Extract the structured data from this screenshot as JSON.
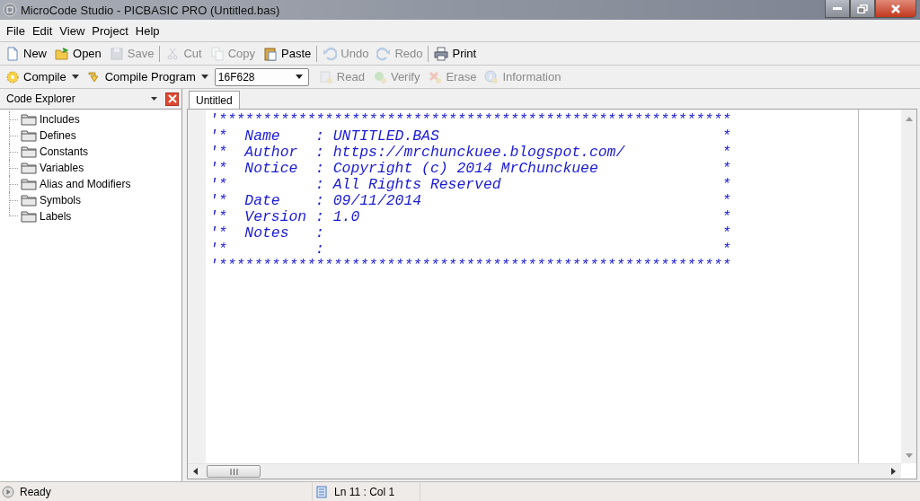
{
  "window": {
    "title": "MicroCode Studio - PICBASIC PRO (Untitled.bas)"
  },
  "menu": [
    "File",
    "Edit",
    "View",
    "Project",
    "Help"
  ],
  "toolbar": [
    {
      "kind": "button",
      "label": "New",
      "disabled": false
    },
    {
      "kind": "button",
      "label": "Open",
      "disabled": false
    },
    {
      "kind": "button",
      "label": "Save",
      "disabled": true
    },
    {
      "kind": "separator"
    },
    {
      "kind": "button",
      "label": "Cut",
      "disabled": true
    },
    {
      "kind": "button",
      "label": "Copy",
      "disabled": true
    },
    {
      "kind": "button",
      "label": "Paste",
      "disabled": false
    },
    {
      "kind": "separator"
    },
    {
      "kind": "button",
      "label": "Undo",
      "disabled": true
    },
    {
      "kind": "button",
      "label": "Redo",
      "disabled": true
    },
    {
      "kind": "separator"
    },
    {
      "kind": "button",
      "label": "Print",
      "disabled": false
    }
  ],
  "compile_bar": {
    "compile": "Compile",
    "compile_program": "Compile Program",
    "device": "16F628",
    "tools": [
      {
        "label": "Read",
        "disabled": true
      },
      {
        "label": "Verify",
        "disabled": true
      },
      {
        "label": "Erase",
        "disabled": true
      },
      {
        "label": "Information",
        "disabled": true
      }
    ]
  },
  "code_explorer": {
    "title": "Code Explorer",
    "items": [
      "Includes",
      "Defines",
      "Constants",
      "Variables",
      "Alias and Modifiers",
      "Symbols",
      "Labels"
    ]
  },
  "tabs": [
    {
      "label": "Untitled",
      "selected": true
    }
  ],
  "editor": {
    "lines": [
      {
        "text": "'**********************************************************"
      },
      {
        "text": "'*  Name    : UNTITLED.BAS",
        "end": "*"
      },
      {
        "text": "'*  Author  : https://mrchunckuee.blogspot.com/",
        "end": "*"
      },
      {
        "text": "'*  Notice  : Copyright (c) 2014 MrChunckuee",
        "end": "*"
      },
      {
        "text": "'*          : All Rights Reserved",
        "end": "*"
      },
      {
        "text": "'*  Date    : 09/11/2014",
        "end": "*"
      },
      {
        "text": "'*  Version : 1.0",
        "end": "*"
      },
      {
        "text": "'*  Notes   :",
        "end": "*"
      },
      {
        "text": "'*          :",
        "end": "*"
      },
      {
        "text": "'**********************************************************"
      }
    ]
  },
  "status_bar": {
    "state": "Ready",
    "position": "Ln 11 : Col 1"
  }
}
